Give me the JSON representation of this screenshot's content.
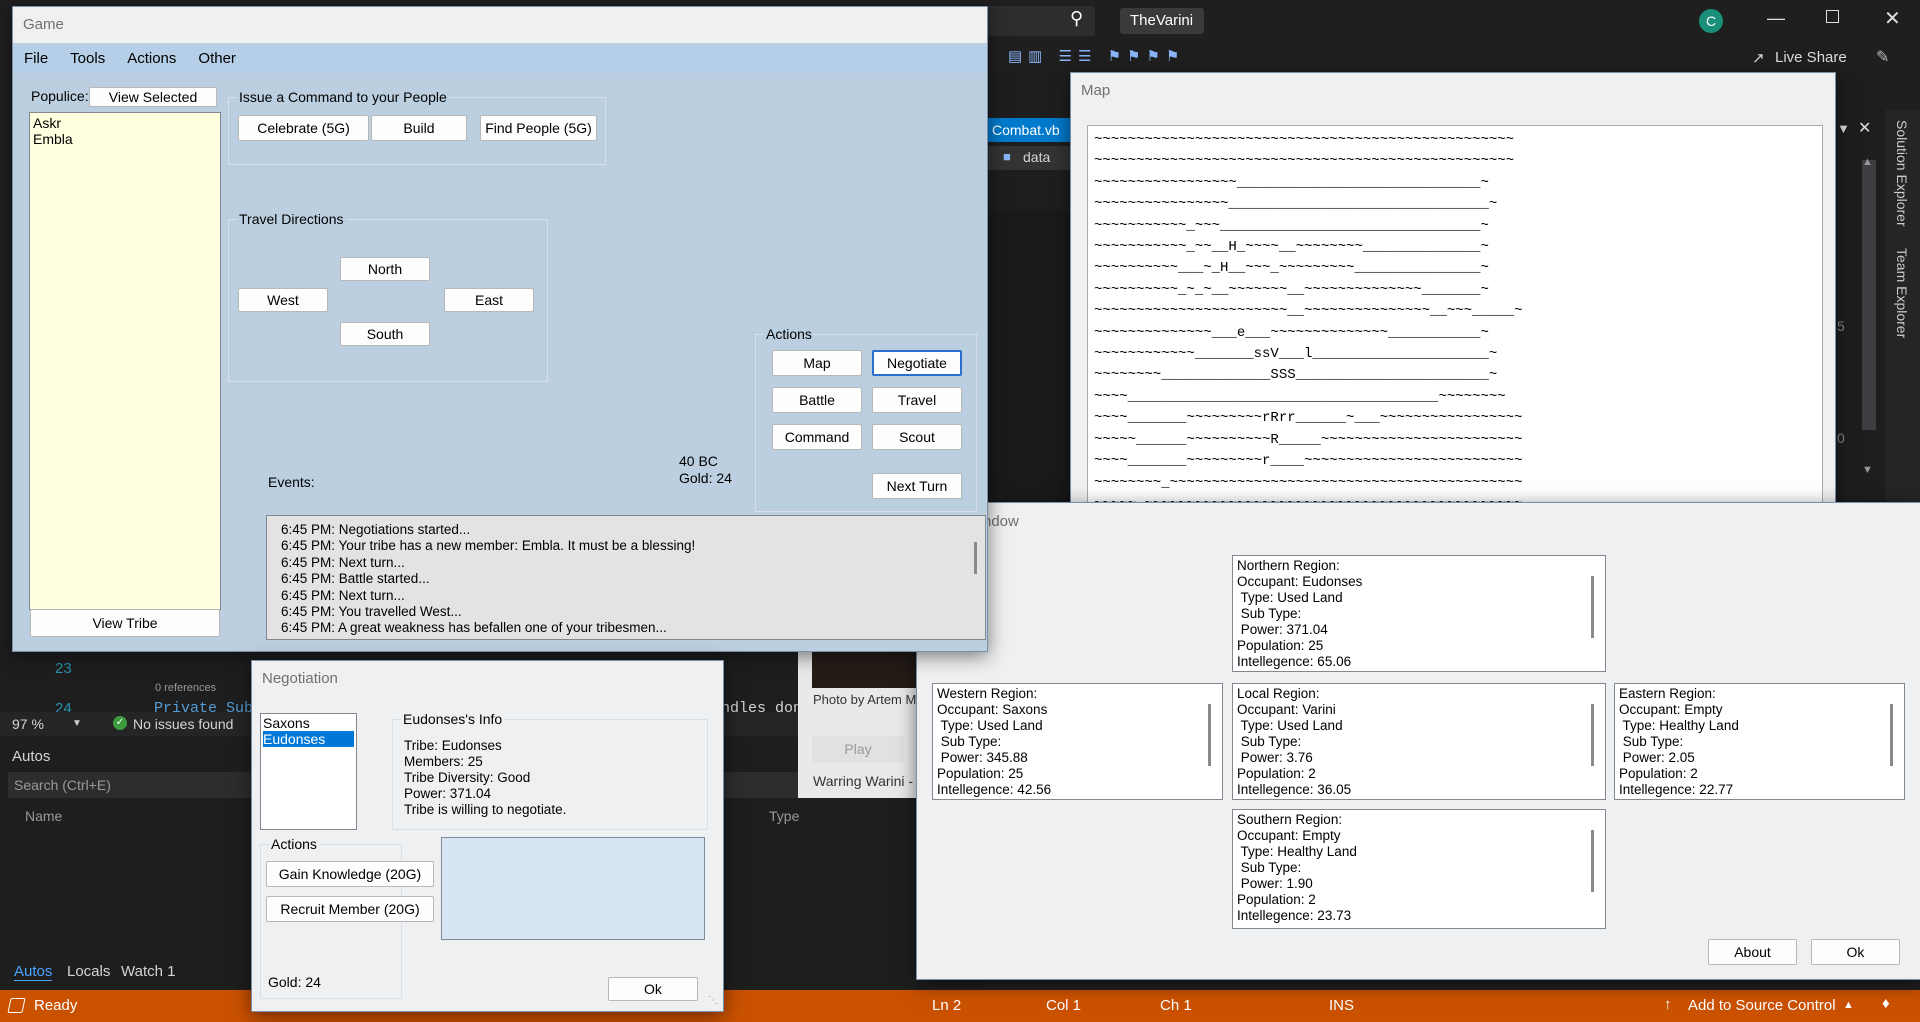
{
  "vs": {
    "title": "TheVarini",
    "avatar": "C",
    "live_share": "Live Share",
    "tab_file": "Combat.vb",
    "tab_data": "data",
    "solution_explorer": "Solution Explorer",
    "team_explorer": "Team Explorer",
    "gutter_15": "5",
    "gutter_0": "0",
    "line_23": "23",
    "line_24": "24",
    "refs": "0 references",
    "code_line": "Private Sub",
    "code_handles": "ndles done",
    "zoom": "97 %",
    "issues": "No issues found",
    "autos_title": "Autos",
    "search_placeholder": "Search (Ctrl+E)",
    "col_name": "Name",
    "col_type": "Type",
    "bottom_tabs": [
      "Autos",
      "Locals",
      "Watch 1"
    ],
    "photo_by": "Photo by Artem M",
    "play": "Play",
    "warring": "Warring Warini - /",
    "status": {
      "ready": "Ready",
      "ln": "Ln 2",
      "col": "Col 1",
      "ch": "Ch 1",
      "ins": "INS",
      "source_control": "Add to Source Control"
    }
  },
  "game": {
    "title": "Game",
    "menu": [
      "File",
      "Tools",
      "Actions",
      "Other"
    ],
    "populace_label": "Populice:",
    "view_selected": "View Selected",
    "members": [
      "Askr",
      "Embla"
    ],
    "view_tribe": "View Tribe",
    "command_group": "Issue a Command to your People",
    "celebrate": "Celebrate (5G)",
    "build": "Build",
    "find_people": "Find People (5G)",
    "travel_group": "Travel Directions",
    "north": "North",
    "west": "West",
    "east": "East",
    "south": "South",
    "actions_group": "Actions",
    "map": "Map",
    "negotiate": "Negotiate",
    "battle": "Battle",
    "travel": "Travel",
    "command": "Command",
    "scout": "Scout",
    "next_turn": "Next Turn",
    "year": "40 BC",
    "gold": "Gold: 24",
    "events_label": "Events:",
    "events": [
      "6:45 PM: Negotiations started...",
      "6:45 PM: Your tribe has a new member: Embla. It must be a blessing!",
      "6:45 PM: Next turn...",
      "6:45 PM: Battle started...",
      "6:45 PM: Next turn...",
      "6:45 PM: You travelled West...",
      "6:45 PM: A great weakness has befallen one of your tribesmen..."
    ]
  },
  "map": {
    "title": "Map",
    "lines": [
      "~~~~~~~~~~~~~~~~~~~~~~~~~~~~~~~~~~~~~~~~~~~~~~~~~~",
      "~~~~~~~~~~~~~~~~~~~~~~~~~~~~~~~~~~~~~~~~~~~~~~~~~~",
      "~~~~~~~~~~~~~~~~~_____________________________~",
      "~~~~~~~~~~~~~~~~_______________________________~",
      "~~~~~~~~~~~_~~~_______________________________~",
      "~~~~~~~~~~~_~~__H_~~~~__~~~~~~~~______________~",
      "~~~~~~~~~~___~_H__~~~_~~~~~~~~~_______________~",
      "~~~~~~~~~~_~_~__~~~~~~~__~~~~~~~~~~~~~~_______~",
      "~~~~~~~~~~~~~~~~~~~~~~~__~~~~~~~~~~~~~~~__~~~_____~",
      "~~~~~~~~~~~~~~___e___~~~~~~~~~~~~~~___________~",
      "~~~~~~~~~~~~_______ssV___l_____________________~",
      "~~~~~~~~_____________SSS_______________________~",
      "~~~~_____________________________________~~~~~~~~",
      "~~~~_______~~~~~~~~~rRrr______~___~~~~~~~~~~~~~~~~~",
      "~~~~~______~~~~~~~~~~R_____~~~~~~~~~~~~~~~~~~~~~~~~",
      "~~~~_______~~~~~~~~~r____~~~~~~~~~~~~~~~~~~~~~~~~~~",
      "~~~~~~~~_~~~~~~~~~~~~~~~~~~~~~~~~~~~~~~~~~~~~~~~~~~",
      "~~~~~_~~~~~~~~~~~~~~~~~~~~~~~~~~~~~~~~~~~~~~~~~~~~~"
    ]
  },
  "scout": {
    "title_fragment": "ndow",
    "northern": [
      "Northern Region:",
      "Occupant: Eudonses",
      " Type: Used Land",
      " Sub Type:",
      " Power: 371.04",
      "Population: 25",
      "Intellegence: 65.06"
    ],
    "western": [
      "Western Region:",
      "Occupant: Saxons",
      " Type: Used Land",
      " Sub Type:",
      " Power: 345.88",
      "Population: 25",
      "Intellegence: 42.56"
    ],
    "local": [
      "Local Region:",
      "Occupant: Varini",
      " Type: Used Land",
      " Sub Type:",
      " Power: 3.76",
      "Population: 2",
      "Intellegence: 36.05"
    ],
    "eastern": [
      "Eastern Region:",
      "Occupant: Empty",
      " Type: Healthy Land",
      " Sub Type:",
      " Power: 2.05",
      "Population: 2",
      "Intellegence: 22.77"
    ],
    "southern": [
      "Southern Region:",
      "Occupant: Empty",
      " Type: Healthy Land",
      " Sub Type:",
      " Power: 1.90",
      "Population: 2",
      "Intellegence: 23.73"
    ],
    "about": "About",
    "ok": "Ok"
  },
  "negotiation": {
    "title": "Negotiation",
    "tribes": [
      "Saxons",
      "Eudonses"
    ],
    "info_group": "Eudonses's Info",
    "info": [
      "Tribe: Eudonses",
      "Members: 25",
      "Tribe Diversity: Good",
      "Power: 371.04",
      "Tribe is willing to negotiate."
    ],
    "actions_group": "Actions",
    "gain_knowledge": "Gain Knowledge (20G)",
    "recruit": "Recruit Member (20G)",
    "gold": "Gold: 24",
    "ok": "Ok"
  }
}
